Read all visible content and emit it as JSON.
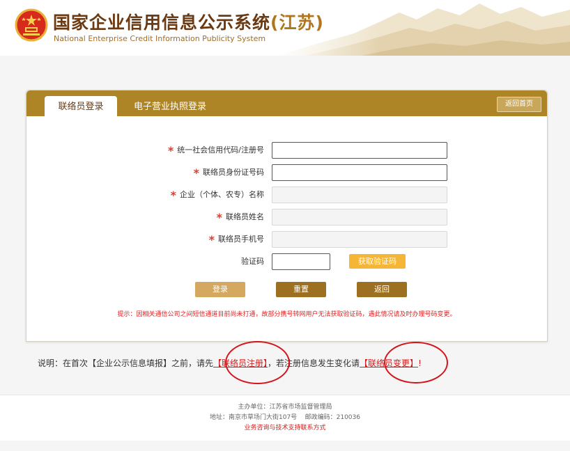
{
  "header": {
    "title": "国家企业信用信息公示系统",
    "province": "(江苏)",
    "subtitle": "National Enterprise Credit Information Publicity System"
  },
  "tabs": {
    "liaison_login": "联络员登录",
    "license_login": "电子营业执照登录",
    "home": "返回首页"
  },
  "form": {
    "fields": [
      {
        "label": "统一社会信用代码/注册号",
        "required": true,
        "value": ""
      },
      {
        "label": "联络员身份证号码",
        "required": true,
        "value": ""
      },
      {
        "label": "企业（个体、农专）名称",
        "required": true,
        "value": ""
      },
      {
        "label": "联络员姓名",
        "required": true,
        "value": ""
      },
      {
        "label": "联络员手机号",
        "required": true,
        "value": ""
      },
      {
        "label": "验证码",
        "required": false,
        "value": ""
      }
    ],
    "required_mark": "*",
    "get_code": "获取验证码",
    "login": "登录",
    "reset": "重置",
    "back": "返回",
    "hint": "提示：因相关通信公司之间短信通道目前尚未打通，故部分携号转网用户无法获取验证码，遇此情况请及时办理号码变更。"
  },
  "note": {
    "prefix": "说明：在首次【企业公示信息填报】之前，请先",
    "register_link": "【联络员注册】",
    "middle": "，若注册信息发生变化请",
    "change_link": "【联络员变更】",
    "suffix": "!"
  },
  "footer": {
    "sponsor": "主办单位：江苏省市场监督管理局",
    "address": "地址：南京市草场门大街107号    邮政编码：210036",
    "contact": "业务咨询与技术支持联系方式"
  },
  "colors": {
    "brand_bar": "#ad8527",
    "title_brown": "#6b3a12",
    "sms_button": "#f5b638",
    "highlight_circle": "#d4141c"
  }
}
